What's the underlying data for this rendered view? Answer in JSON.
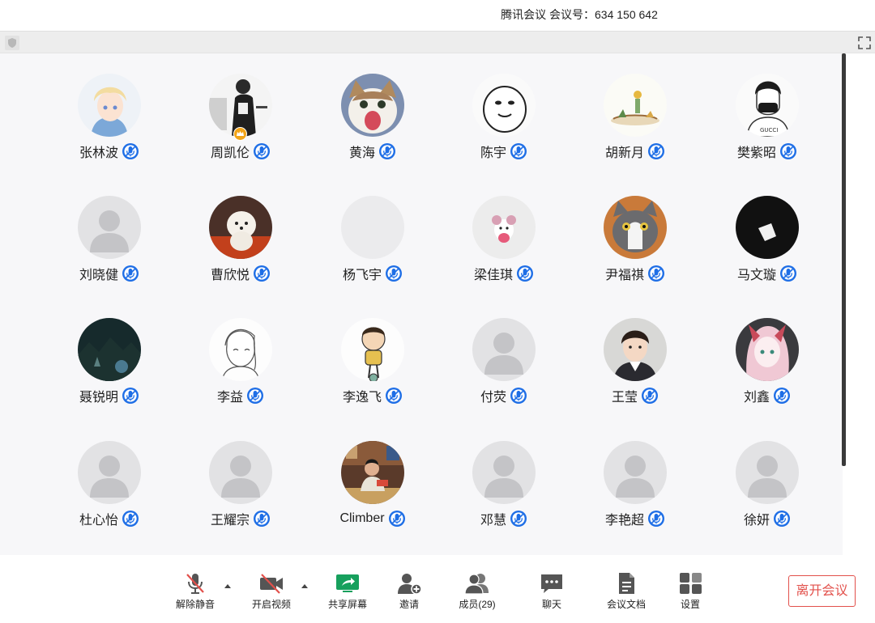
{
  "window": {
    "title": "腾讯会议 会议号：634 150 642"
  },
  "colors": {
    "mic_blue": "#1e6ee6",
    "leave_red": "#e2504b",
    "share_green": "#17a05d"
  },
  "participants": [
    {
      "name": "张林波",
      "avatar": "anime-boy"
    },
    {
      "name": "周凯伦",
      "avatar": "photo-person-bw",
      "host": true
    },
    {
      "name": "黄海",
      "avatar": "cat-meme"
    },
    {
      "name": "陈宇",
      "avatar": "meme-face"
    },
    {
      "name": "胡新月",
      "avatar": "little-prince-drawing"
    },
    {
      "name": "樊紫昭",
      "avatar": "sketch-masked-man"
    },
    {
      "name": "刘晓健",
      "avatar": "default"
    },
    {
      "name": "曹欣悦",
      "avatar": "white-dog"
    },
    {
      "name": "杨飞宇",
      "avatar": "blank"
    },
    {
      "name": "梁佳琪",
      "avatar": "pink-doodle"
    },
    {
      "name": "尹福祺",
      "avatar": "grey-cat"
    },
    {
      "name": "马文璇",
      "avatar": "dark-photo"
    },
    {
      "name": "聂锐明",
      "avatar": "night-landscape"
    },
    {
      "name": "李益",
      "avatar": "sketch-girl"
    },
    {
      "name": "李逸飞",
      "avatar": "cartoon-boy"
    },
    {
      "name": "付荧",
      "avatar": "default"
    },
    {
      "name": "王莹",
      "avatar": "portrait-man"
    },
    {
      "name": "刘鑫",
      "avatar": "anime-pink-hair"
    },
    {
      "name": "杜心怡",
      "avatar": "default"
    },
    {
      "name": "王耀宗",
      "avatar": "default"
    },
    {
      "name": "Climber",
      "avatar": "photo-person-color"
    },
    {
      "name": "邓慧",
      "avatar": "default"
    },
    {
      "name": "李艳超",
      "avatar": "default"
    },
    {
      "name": "徐妍",
      "avatar": "default"
    }
  ],
  "toolbar": {
    "unmute": "解除静音",
    "start_video": "开启视频",
    "share_screen": "共享屏幕",
    "invite": "邀请",
    "members": "成员(29)",
    "chat": "聊天",
    "docs": "会议文档",
    "settings": "设置",
    "leave": "离开会议"
  },
  "icons": {
    "mic": "mic-muted-icon",
    "video": "video-off-icon",
    "share": "share-screen-icon",
    "invite": "invite-icon",
    "members": "members-icon",
    "chat": "chat-icon",
    "docs": "document-icon",
    "settings": "settings-grid-icon"
  }
}
